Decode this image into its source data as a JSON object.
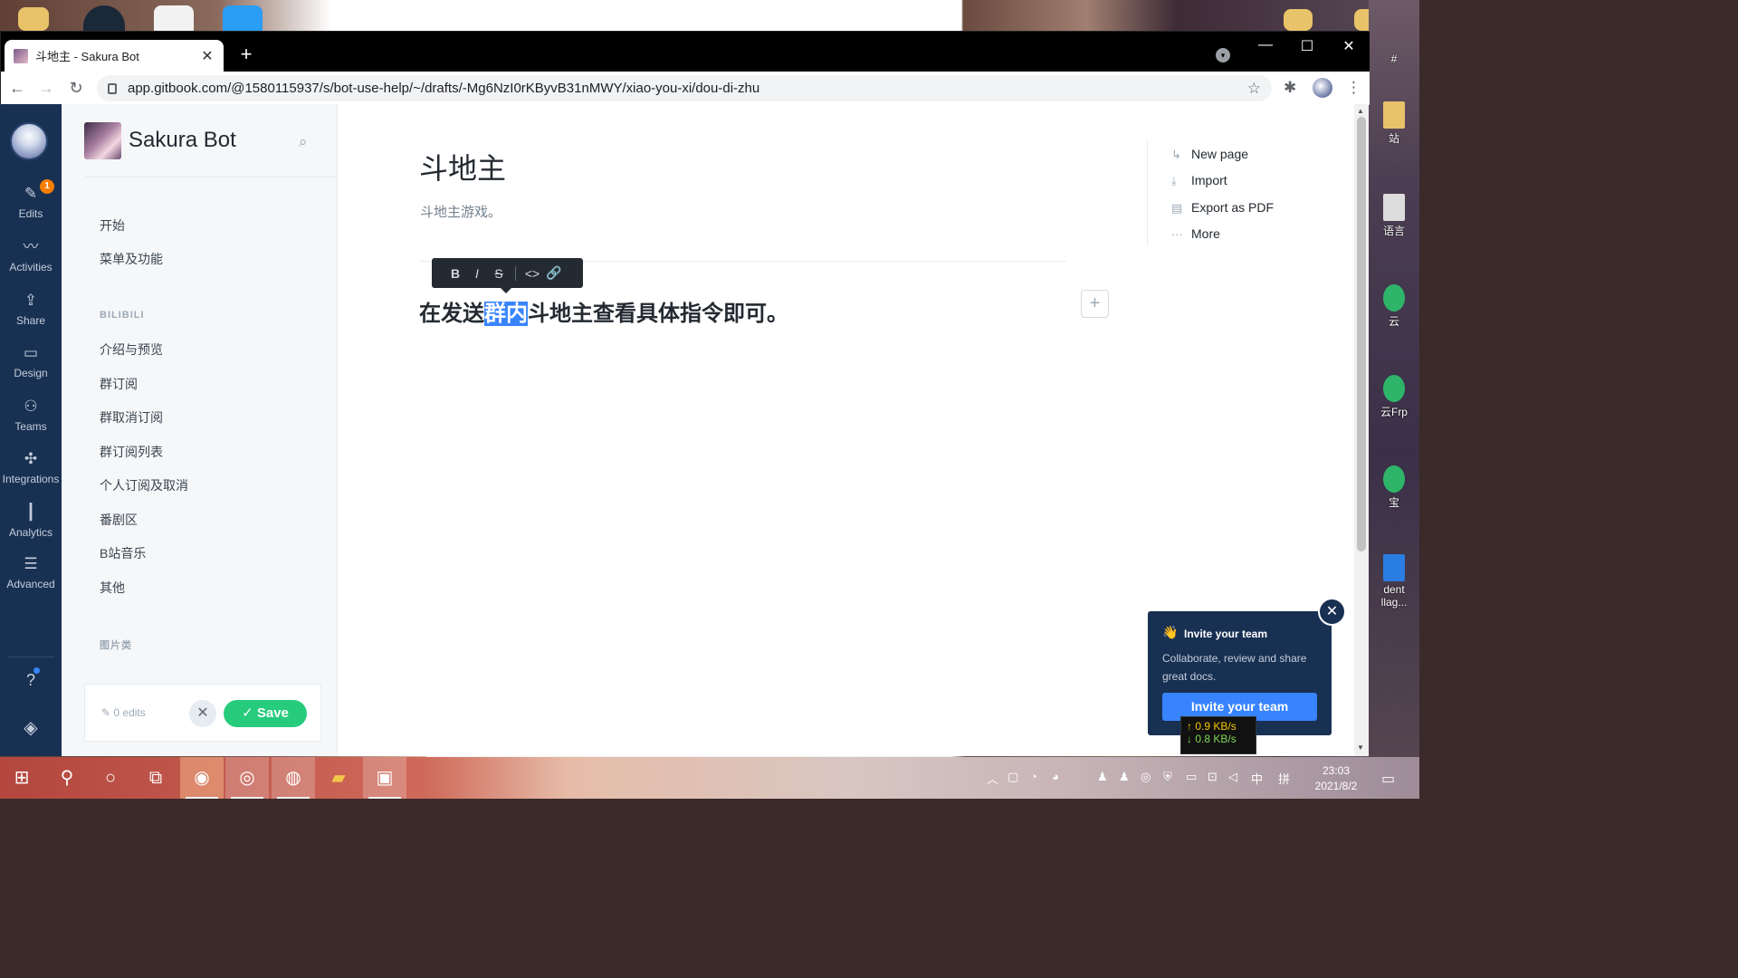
{
  "browser": {
    "tab_title": "斗地主 - Sakura Bot",
    "url": "app.gitbook.com/@1580115937/s/bot-use-help/~/drafts/-Mg6NzI0rKByvB31nMWY/xiao-you-xi/dou-di-zhu"
  },
  "rail": {
    "edits_badge": "1",
    "items": [
      {
        "label": "Edits",
        "icon": "pencil-icon"
      },
      {
        "label": "Activities",
        "icon": "activity-icon"
      },
      {
        "label": "Share",
        "icon": "share-icon"
      },
      {
        "label": "Design",
        "icon": "paint-roller-icon"
      },
      {
        "label": "Teams",
        "icon": "people-icon"
      },
      {
        "label": "Integrations",
        "icon": "puzzle-icon"
      },
      {
        "label": "Analytics",
        "icon": "bar-chart-icon"
      },
      {
        "label": "Advanced",
        "icon": "sliders-icon"
      }
    ],
    "help": "?"
  },
  "sidebar": {
    "space_name": "Sakura Bot",
    "items": [
      "开始",
      "菜单及功能"
    ],
    "group1": "BILIBILI",
    "group1_items": [
      "介绍与预览",
      "群订阅",
      "群取消订阅",
      "群订阅列表",
      "个人订阅及取消",
      "番剧区",
      "B站音乐",
      "其他"
    ],
    "group2": "图片类",
    "edits_label": "0 edits",
    "save_label": "Save"
  },
  "document": {
    "title": "斗地主",
    "description": "斗地主游戏。",
    "line_before": "在发送",
    "line_selected": "群内",
    "line_after": "斗地主查看具体指令即可。",
    "toolbar": [
      "B",
      "I",
      "S",
      "<>",
      "link"
    ]
  },
  "page_actions": [
    {
      "label": "New page",
      "icon": "new-page-icon"
    },
    {
      "label": "Import",
      "icon": "import-icon"
    },
    {
      "label": "Export as PDF",
      "icon": "pdf-icon"
    },
    {
      "label": "More",
      "icon": "more-icon"
    }
  ],
  "invite": {
    "title": "Invite your team",
    "text": "Collaborate, review and share great docs.",
    "button": "Invite your team"
  },
  "netspeed": {
    "up": "↑ 0.9 KB/s",
    "down": "↓ 0.8 KB/s"
  },
  "taskbar": {
    "time": "23:03",
    "date": "2021/8/2",
    "ime": "中",
    "ime2": "拼"
  },
  "desktop_labels": [
    "#",
    "站",
    "语言",
    "云",
    "云Frp",
    "宝",
    "dent",
    "llag..."
  ]
}
